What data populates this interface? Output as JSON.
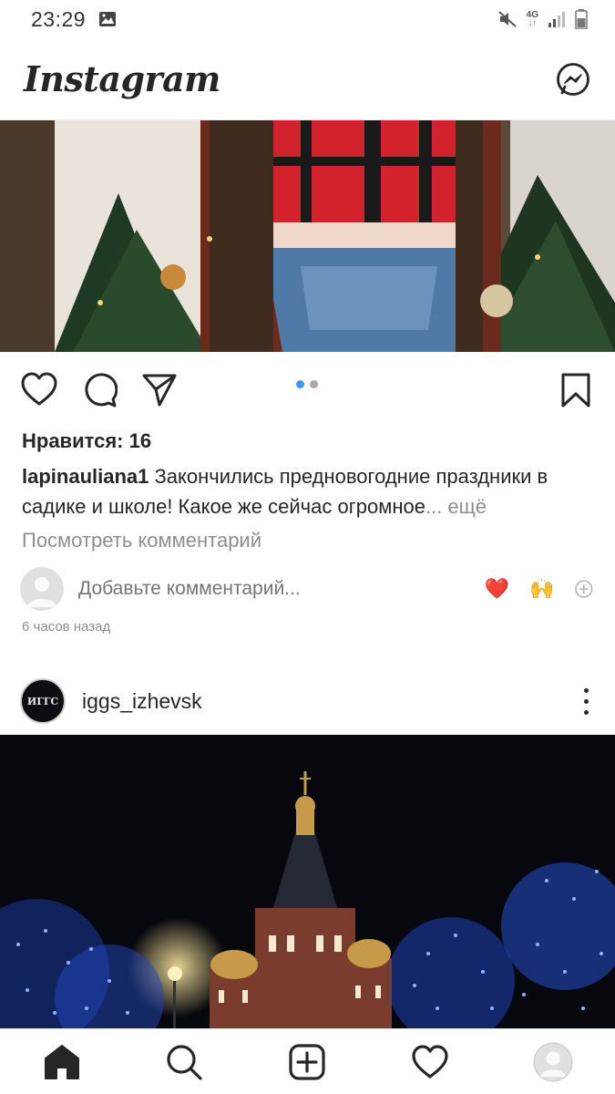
{
  "status_bar": {
    "time": "23:29",
    "network": "4G"
  },
  "header": {
    "logo": "Instagram"
  },
  "post1": {
    "likes_label": "Нравится: 16",
    "username": "lapinauliana1",
    "caption": "Закончились предновогодние праздники в садике и школе! Какое же сейчас огромное",
    "more": "... ещё",
    "view_comments": "Посмотреть комментарий",
    "comment_placeholder": "Добавьте комментарий...",
    "reaction_1": "❤️",
    "reaction_2": "🙌",
    "timestamp": "6 часов назад",
    "carousel": {
      "count": 2,
      "active_index": 0
    }
  },
  "post2": {
    "username": "iggs_izhevsk",
    "avatar_text": "ИГГС"
  },
  "colors": {
    "text": "#262626",
    "secondary": "#8e8e8e",
    "accent": "#3897f0",
    "heart": "#ed4956"
  }
}
